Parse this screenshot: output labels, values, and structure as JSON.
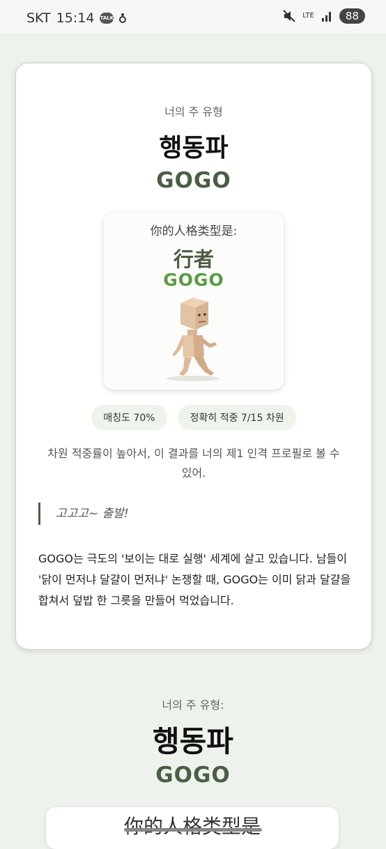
{
  "status_bar": {
    "carrier": "SKT",
    "time": "15:14",
    "talk_icon_text": "TALK",
    "network": "LTE",
    "battery": "88"
  },
  "result_card": {
    "label": "너의 주 유형",
    "type_korean": "행동파",
    "type_english": "GOGO",
    "image_card": {
      "label": "你的人格类型是:",
      "type_chinese": "行者",
      "type_english": "GOGO"
    },
    "badges": {
      "match": "매칭도 70%",
      "accuracy": "정확히 적중 7/15 차원"
    },
    "description": "차원 적중률이 높아서, 이 결과를 너의 제1 인격 프로필로 볼 수 있어.",
    "quote": "고고고~ 출발!",
    "body": "GOGO는 극도의 '보이는 대로 실행' 세계에 살고 있습니다. 남들이 '닭이 먼저냐 달걀이 먼저냐' 논쟁할 때, GOGO는 이미 닭과 달걀을 합쳐서 덮밥 한 그릇을 만들어 먹었습니다."
  },
  "section2": {
    "label": "너의 주 유형:",
    "type_korean": "행동파",
    "type_english": "GOGO",
    "card_text": "你的人格类型是"
  }
}
